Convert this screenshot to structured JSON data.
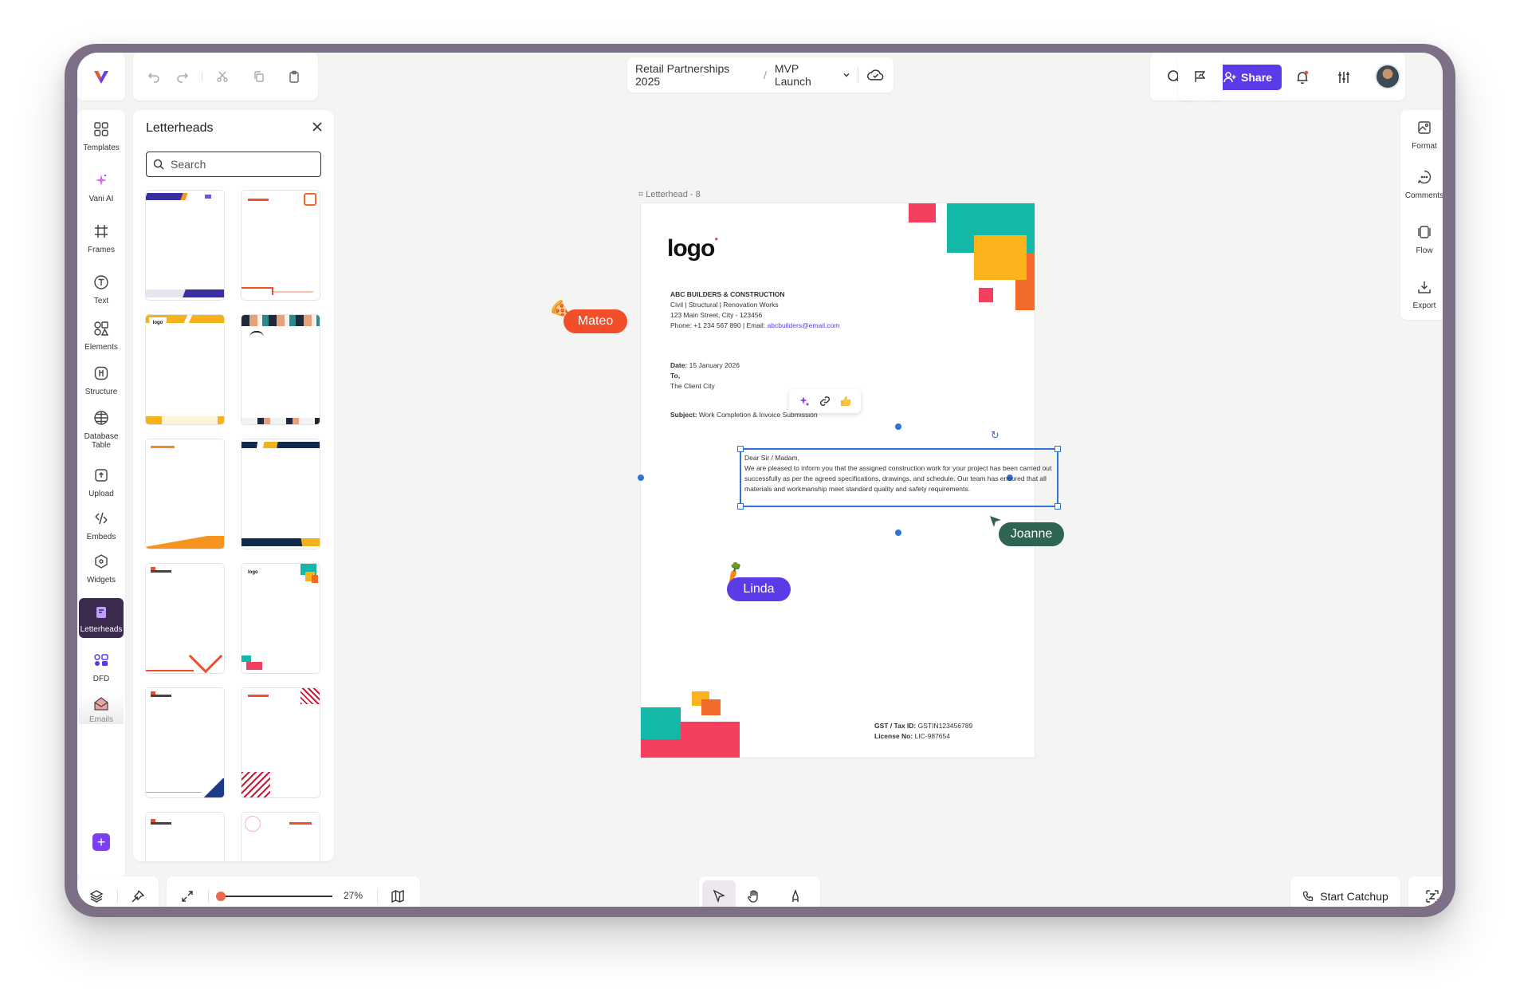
{
  "breadcrumb": {
    "project": "Retail Partnerships 2025",
    "board": "MVP Launch"
  },
  "header": {
    "share_label": "Share"
  },
  "left_toolbar": {
    "items": [
      {
        "label": "Templates"
      },
      {
        "label": "Vani AI"
      },
      {
        "label": "Frames"
      },
      {
        "label": "Text"
      },
      {
        "label": "Elements"
      },
      {
        "label": "Structure"
      },
      {
        "label": "Database Table"
      },
      {
        "label": "Upload"
      },
      {
        "label": "Embeds"
      },
      {
        "label": "Widgets"
      },
      {
        "label": "Letterheads"
      },
      {
        "label": "DFD"
      },
      {
        "label": "Emails"
      }
    ]
  },
  "panel": {
    "title": "Letterheads",
    "search_placeholder": "Search"
  },
  "right_toolbar": {
    "items": [
      {
        "label": "Format"
      },
      {
        "label": "Comments"
      },
      {
        "label": "Flow"
      },
      {
        "label": "Export"
      }
    ]
  },
  "bottom": {
    "zoom": "27%",
    "catchup_label": "Start Catchup"
  },
  "canvas": {
    "frame_label": "Letterhead - 8",
    "letterhead": {
      "logo": "logo",
      "company": "ABC BUILDERS & CONSTRUCTION",
      "services": "Civil | Structural | Renovation Works",
      "address": "123 Main Street, City - 123456",
      "phone_prefix": "Phone: +1 234 567 890 | Email: ",
      "email": "abcbuilders@email.com",
      "date_label": "Date:",
      "date_value": "15 January 2026",
      "to_label": "To,",
      "to_value": "The Client City",
      "subject_label": "Subject:",
      "subject_value": "Work Completion & Invoice Submission",
      "salutation": "Dear Sir / Madam,",
      "body": "We are pleased to inform you that the assigned construction work for your project has been carried out successfully as per the agreed specifications, drawings, and schedule. Our team has ensured that all materials and workmanship meet standard quality and safety requirements.",
      "gst_label": "GST / Tax ID:",
      "gst_value": "GSTIN123456789",
      "license_label": "License No:",
      "license_value": "LIC-987654"
    },
    "collaborators": [
      {
        "name": "Mateo",
        "color": "#f24e2a"
      },
      {
        "name": "Joanne",
        "color": "#2f6354"
      },
      {
        "name": "Linda",
        "color": "#5b3be8"
      }
    ]
  },
  "colors": {
    "accent": "#5b3be8",
    "selection": "#2f73d9"
  }
}
